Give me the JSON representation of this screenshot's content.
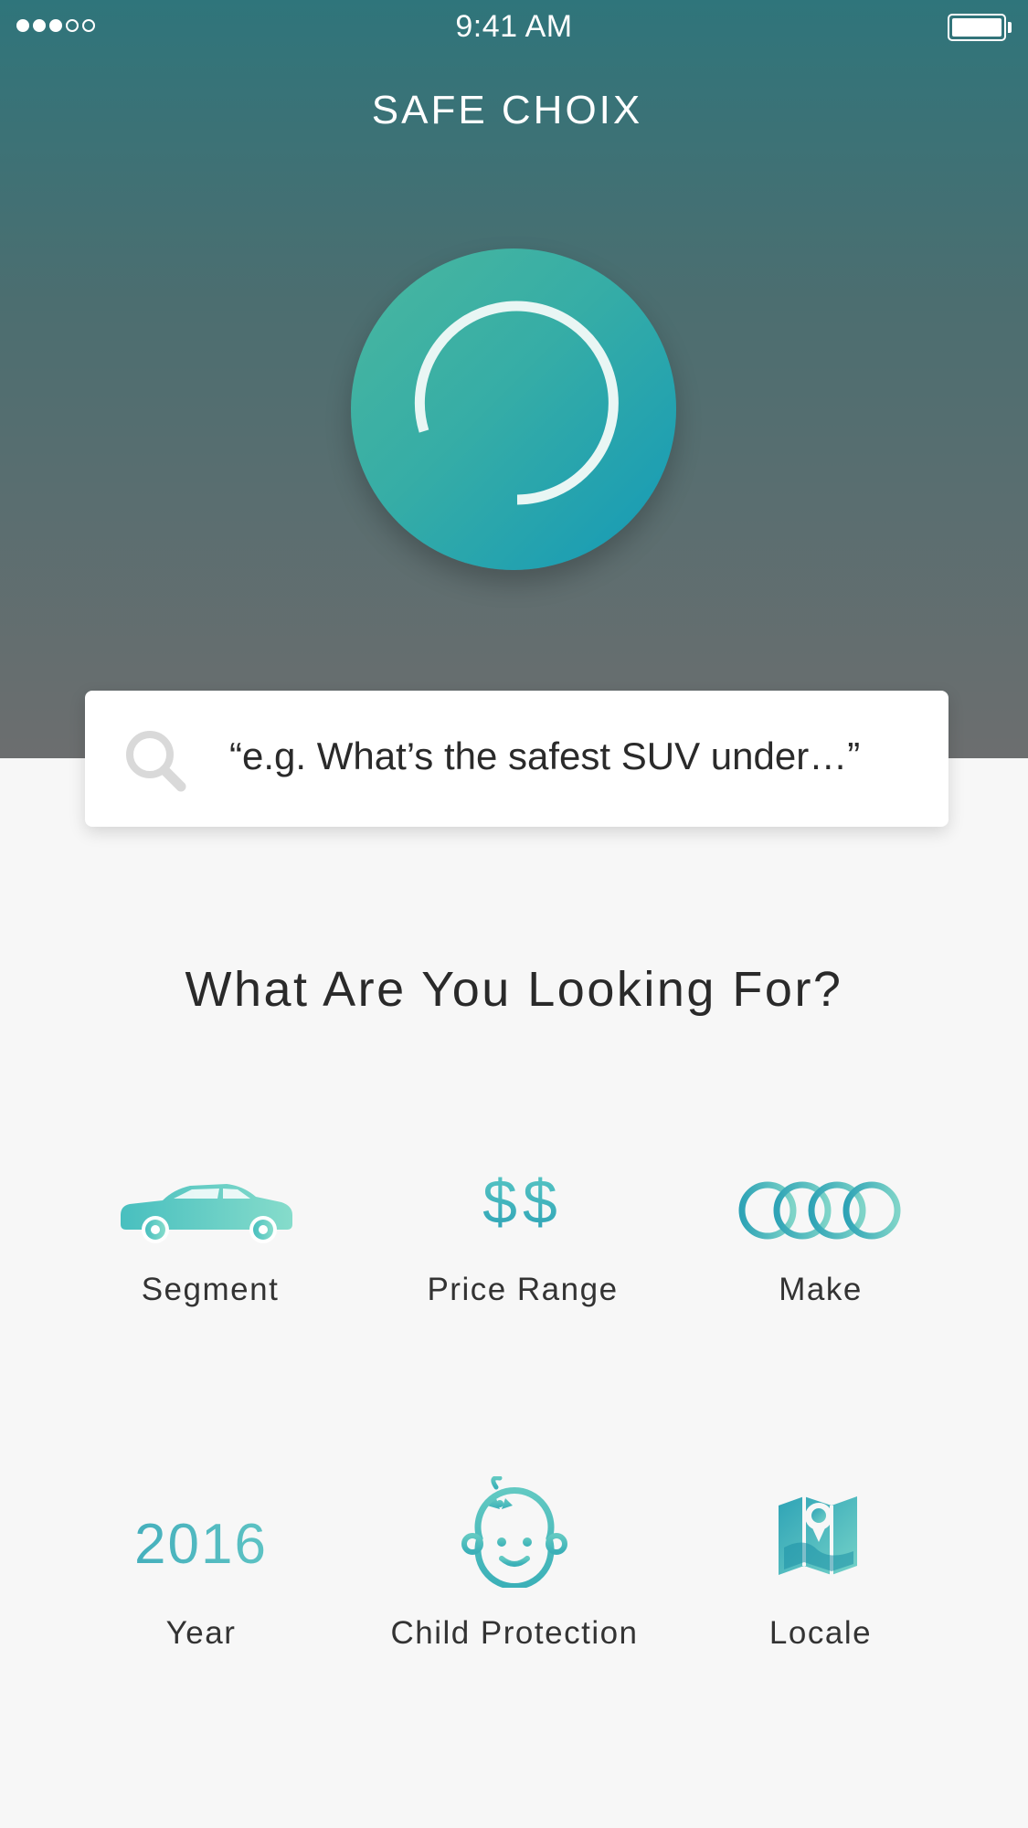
{
  "status_bar": {
    "time": "9:41 AM",
    "signal_bars_filled": 3,
    "signal_bars_total": 5
  },
  "header": {
    "title": "SAFE CHOIX"
  },
  "search": {
    "placeholder": "“e.g. What’s the safest SUV under…”"
  },
  "section": {
    "title": "What Are You Looking For?"
  },
  "options": [
    {
      "label": "Segment",
      "icon": "car-icon"
    },
    {
      "label": "Price Range",
      "icon": "dollar-icon",
      "icon_text": "$$"
    },
    {
      "label": "Make",
      "icon": "rings-logo-icon"
    },
    {
      "label": "Year",
      "icon": "year-text",
      "icon_text": "2016"
    },
    {
      "label": "Child Protection",
      "icon": "baby-face-icon"
    },
    {
      "label": "Locale",
      "icon": "map-pin-icon"
    }
  ],
  "colors": {
    "accent_teal": "#3aaeb9",
    "accent_green": "#4ab79f",
    "header_top": "#2f757b",
    "header_bottom": "#6c6e6f",
    "background": "#f7f7f7",
    "text_dark": "#2a2a2a"
  }
}
